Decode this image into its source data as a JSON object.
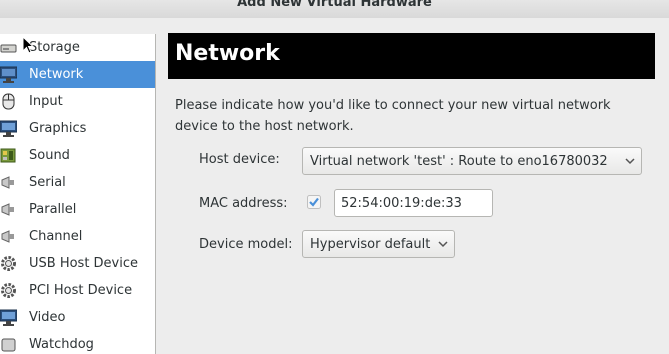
{
  "window": {
    "title": "Add New Virtual Hardware"
  },
  "sidebar": {
    "items": [
      {
        "label": "Storage",
        "icon": "storage-drive-icon"
      },
      {
        "label": "Network",
        "icon": "network-monitor-icon",
        "selected": true
      },
      {
        "label": "Input",
        "icon": "mouse-icon"
      },
      {
        "label": "Graphics",
        "icon": "display-icon"
      },
      {
        "label": "Sound",
        "icon": "sound-card-icon"
      },
      {
        "label": "Serial",
        "icon": "serial-plug-icon"
      },
      {
        "label": "Parallel",
        "icon": "parallel-plug-icon"
      },
      {
        "label": "Channel",
        "icon": "channel-plug-icon"
      },
      {
        "label": "USB Host Device",
        "icon": "usb-gear-icon"
      },
      {
        "label": "PCI Host Device",
        "icon": "pci-gear-icon"
      },
      {
        "label": "Video",
        "icon": "video-monitor-icon"
      },
      {
        "label": "Watchdog",
        "icon": "watchdog-icon"
      }
    ]
  },
  "main": {
    "title": "Network",
    "description": "Please indicate how you'd like to connect your new virtual network device to the host network.",
    "host_device": {
      "label": "Host device:",
      "value": "Virtual network 'test' : Route to eno16780032"
    },
    "mac_address": {
      "label": "MAC address:",
      "checked": true,
      "value": "52:54:00:19:de:33"
    },
    "device_model": {
      "label": "Device model:",
      "value": "Hypervisor default"
    }
  },
  "colors": {
    "selection": "#4a90d9",
    "header_bg": "#000000",
    "window_bg": "#ededed",
    "checkmark": "#4a90d9"
  }
}
